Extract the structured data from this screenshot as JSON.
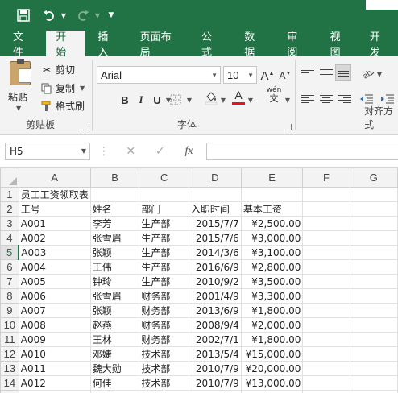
{
  "quick_access": {
    "save_icon": "save-icon",
    "undo_icon": "undo-icon",
    "redo_icon": "redo-icon",
    "customize_icon": "customize-dropdown-icon"
  },
  "tabs": [
    "文件",
    "开始",
    "插入",
    "页面布局",
    "公式",
    "数据",
    "审阅",
    "视图",
    "开发"
  ],
  "active_tab": "开始",
  "ribbon": {
    "paste_label": "粘贴",
    "cut_label": "剪切",
    "copy_label": "复制",
    "format_painter_label": "格式刷",
    "clipboard_group": "剪贴板",
    "font_name": "Arial",
    "font_size": "10",
    "bold": "B",
    "italic": "I",
    "underline": "U",
    "font_color_glyph": "A",
    "wen_label": "wén",
    "wen_sub": "文",
    "font_group": "字体",
    "alignment_group": "对齐方式",
    "font_color": "#e81123"
  },
  "formula_bar": {
    "name_box": "H5",
    "cancel_icon": "✕",
    "enter_icon": "✓",
    "fx_label": "fx",
    "formula": ""
  },
  "sheet": {
    "columns": [
      "A",
      "B",
      "C",
      "D",
      "E",
      "F",
      "G"
    ],
    "rows": [
      {
        "n": "1",
        "cells": [
          "员工工资领取表",
          "",
          "",
          "",
          ""
        ]
      },
      {
        "n": "2",
        "cells": [
          "工号",
          "姓名",
          "部门",
          "入职时间",
          "基本工资"
        ]
      },
      {
        "n": "3",
        "cells": [
          "A001",
          "李芳",
          "生产部",
          "2015/7/7",
          "¥2,500.00"
        ]
      },
      {
        "n": "4",
        "cells": [
          "A002",
          "张雪眉",
          "生产部",
          "2015/7/6",
          "¥3,000.00"
        ]
      },
      {
        "n": "5",
        "cells": [
          "A003",
          "张颖",
          "生产部",
          "2014/3/6",
          "¥3,100.00"
        ]
      },
      {
        "n": "6",
        "cells": [
          "A004",
          "王伟",
          "生产部",
          "2016/6/9",
          "¥2,800.00"
        ]
      },
      {
        "n": "7",
        "cells": [
          "A005",
          "钟玲",
          "生产部",
          "2010/9/2",
          "¥3,500.00"
        ]
      },
      {
        "n": "8",
        "cells": [
          "A006",
          "张雪眉",
          "财务部",
          "2001/4/9",
          "¥3,300.00"
        ]
      },
      {
        "n": "9",
        "cells": [
          "A007",
          "张颖",
          "财务部",
          "2013/6/9",
          "¥1,800.00"
        ]
      },
      {
        "n": "10",
        "cells": [
          "A008",
          "赵燕",
          "财务部",
          "2008/9/4",
          "¥2,000.00"
        ]
      },
      {
        "n": "11",
        "cells": [
          "A009",
          "王林",
          "财务部",
          "2002/7/1",
          "¥1,800.00"
        ]
      },
      {
        "n": "12",
        "cells": [
          "A010",
          "邓婕",
          "技术部",
          "2013/5/4",
          "¥15,000.00"
        ]
      },
      {
        "n": "13",
        "cells": [
          "A011",
          "魏大勋",
          "技术部",
          "2010/7/9",
          "¥20,000.00"
        ]
      },
      {
        "n": "14",
        "cells": [
          "A012",
          "何佳",
          "技术部",
          "2010/7/9",
          "¥13,000.00"
        ]
      },
      {
        "n": "15",
        "cells": [
          "",
          "",
          "",
          "",
          ""
        ]
      }
    ],
    "selected_column": "H",
    "selected_row": "5"
  }
}
